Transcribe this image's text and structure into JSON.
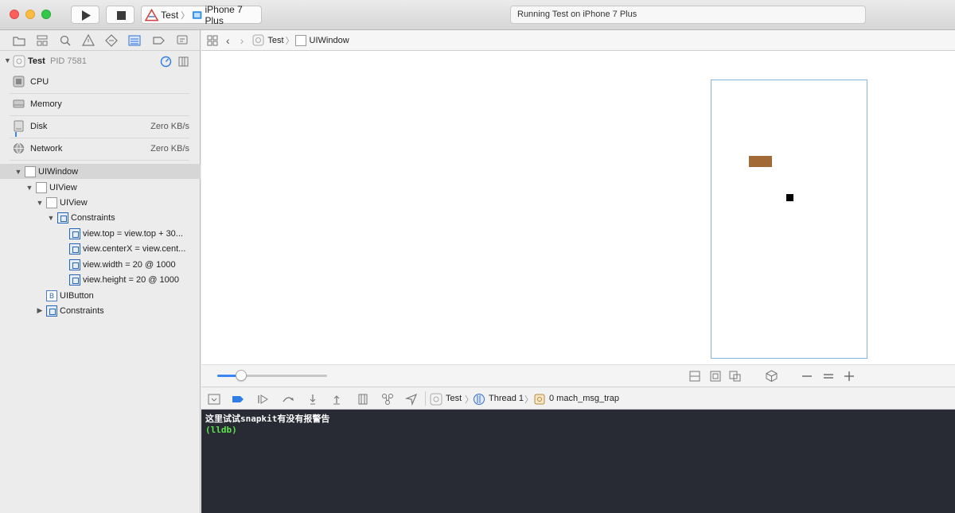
{
  "toolbar": {
    "scheme_app": "Test",
    "scheme_device": "iPhone 7 Plus",
    "activity_status": "Running Test on iPhone 7 Plus"
  },
  "navigator": {
    "tabs": [
      "folder-icon",
      "hierarchy-icon",
      "search-icon",
      "warning-icon",
      "test-diamond-icon",
      "debug-list-icon",
      "breakpoint-icon",
      "report-icon"
    ],
    "process": {
      "name": "Test",
      "pid": "PID 7581"
    },
    "gauges": [
      {
        "label": "CPU",
        "value": ""
      },
      {
        "label": "Memory",
        "value": ""
      },
      {
        "label": "Disk",
        "value": "Zero KB/s"
      },
      {
        "label": "Network",
        "value": "Zero KB/s"
      }
    ],
    "tree": [
      {
        "label": "UIWindow"
      },
      {
        "label": "UIView"
      },
      {
        "label": "UIView"
      },
      {
        "label": "Constraints"
      },
      {
        "label": "view.top = view.top + 30..."
      },
      {
        "label": "view.centerX = view.cent..."
      },
      {
        "label": "view.width = 20 @ 1000"
      },
      {
        "label": "view.height = 20 @ 1000"
      },
      {
        "label": "UIButton"
      },
      {
        "label": "Constraints"
      }
    ]
  },
  "jumpbar": {
    "app": "Test",
    "object": "UIWindow"
  },
  "canvas": {
    "zoom_fraction": 0.22,
    "accent": "#3b86f5",
    "view_color": "#a26a37"
  },
  "debugbar": {
    "app": "Test",
    "thread": "Thread 1",
    "frame": "0 mach_msg_trap"
  },
  "console": {
    "output": "这里试试snapkit有没有报警告",
    "prompt": "(lldb)"
  }
}
